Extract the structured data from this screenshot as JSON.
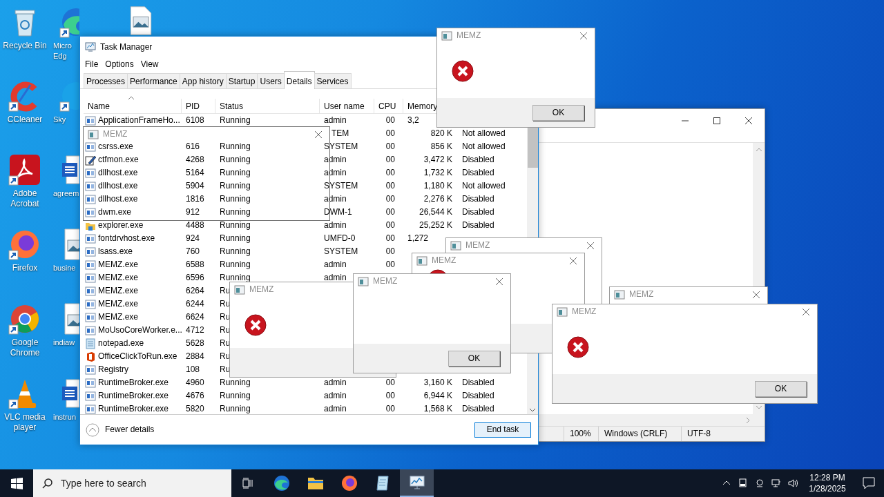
{
  "desktop_icons": [
    {
      "kind": "bin",
      "label": "Recycle Bin",
      "shortcut": false
    },
    {
      "kind": "swirl",
      "label": "Micro Edg",
      "shortcut": true
    },
    {
      "kind": "image",
      "shortcut": false
    },
    {
      "kind": "arc",
      "label": "CCleaner",
      "shortcut": true
    },
    {
      "kind": "circle",
      "label": "Sky",
      "shortcut": true
    },
    {
      "kind": "pdf",
      "label": "Adobe Acrobat",
      "shortcut": true
    },
    {
      "kind": "doc",
      "label": "agreem",
      "shortcut": false
    },
    {
      "kind": "fox",
      "label": "Firefox",
      "shortcut": true
    },
    {
      "kind": "image",
      "label": "busine",
      "shortcut": false
    },
    {
      "kind": "ring",
      "label": "Google Chrome",
      "shortcut": true
    },
    {
      "kind": "image",
      "label": "indiaw",
      "shortcut": false
    },
    {
      "kind": "cone",
      "label": "VLC media player",
      "shortcut": true
    },
    {
      "kind": "doc",
      "label": "instrun",
      "shortcut": false
    }
  ],
  "notepad": {
    "status_bar": [
      "100%",
      "Windows (CRLF)",
      "UTF-8"
    ]
  },
  "task_manager": {
    "title": "Task Manager",
    "menu": [
      "File",
      "Options",
      "View"
    ],
    "tabs": [
      {
        "label": "Processes",
        "selected": false
      },
      {
        "label": "Performance",
        "selected": false
      },
      {
        "label": "App history",
        "selected": false
      },
      {
        "label": "Startup",
        "selected": false
      },
      {
        "label": "Users",
        "selected": false
      },
      {
        "label": "Details",
        "selected": true
      },
      {
        "label": "Services",
        "selected": false
      }
    ],
    "columns": [
      "Name",
      "PID",
      "Status",
      "User name",
      "CPU",
      "Memory"
    ],
    "rows": [
      {
        "kind": "app",
        "name": "ApplicationFrameHo...",
        "pid": "6108",
        "status": "Running",
        "user": "admin",
        "cpu": "00",
        "memory": "3,2",
        "memory_cut": true
      },
      {
        "user": "TEM",
        "user_cut": true,
        "cpu": "00",
        "memory": "820 K",
        "dep": "Not allowed"
      },
      {
        "kind": "app",
        "name": "csrss.exe",
        "pid": "616",
        "status": "Running",
        "user": "SYSTEM",
        "cpu": "00",
        "memory": "856 K",
        "dep": "Not allowed"
      },
      {
        "kind": "pen",
        "name": "ctfmon.exe",
        "pid": "4268",
        "status": "Running",
        "user": "admin",
        "cpu": "00",
        "memory": "3,472 K",
        "dep": "Disabled"
      },
      {
        "kind": "app",
        "name": "dllhost.exe",
        "pid": "5164",
        "status": "Running",
        "user": "admin",
        "cpu": "00",
        "memory": "1,732 K",
        "dep": "Disabled"
      },
      {
        "kind": "app",
        "name": "dllhost.exe",
        "pid": "5904",
        "status": "Running",
        "user": "SYSTEM",
        "cpu": "00",
        "memory": "1,180 K",
        "dep": "Not allowed"
      },
      {
        "kind": "app",
        "name": "dllhost.exe",
        "pid": "1816",
        "status": "Running",
        "user": "admin",
        "cpu": "00",
        "memory": "2,276 K",
        "dep": "Disabled"
      },
      {
        "kind": "app",
        "name": "dwm.exe",
        "pid": "912",
        "status": "Running",
        "user": "DWM-1",
        "cpu": "00",
        "memory": "26,544 K",
        "dep": "Disabled"
      },
      {
        "kind": "folder",
        "name": "explorer.exe",
        "pid": "4488",
        "status": "Running",
        "user": "admin",
        "cpu": "00",
        "memory": "25,252 K",
        "dep": "Disabled"
      },
      {
        "kind": "app",
        "name": "fontdrvhost.exe",
        "pid": "924",
        "status": "Running",
        "user": "UMFD-0",
        "cpu": "00",
        "memory": "1,272",
        "memory_cut": true
      },
      {
        "kind": "app",
        "name": "lsass.exe",
        "pid": "760",
        "status": "Running",
        "user": "SYSTEM",
        "cpu": "00"
      },
      {
        "kind": "app",
        "name": "MEMZ.exe",
        "pid": "6588",
        "status": "Running",
        "user": "admin",
        "cpu": "00"
      },
      {
        "kind": "app",
        "name": "MEMZ.exe",
        "pid": "6596",
        "status": "Running",
        "user": "admin"
      },
      {
        "kind": "app",
        "name": "MEMZ.exe",
        "pid": "6264",
        "status": "Ru"
      },
      {
        "kind": "app",
        "name": "MEMZ.exe",
        "pid": "6244",
        "status": "Ru"
      },
      {
        "kind": "app",
        "name": "MEMZ.exe",
        "pid": "6624",
        "status": "Ru"
      },
      {
        "kind": "app",
        "name": "MoUsoCoreWorker.e...",
        "pid": "4712",
        "status": "Ru"
      },
      {
        "kind": "notepad",
        "name": "notepad.exe",
        "pid": "5628",
        "status": "Ru"
      },
      {
        "kind": "office",
        "name": "OfficeClickToRun.exe",
        "pid": "2884",
        "status": "Ru"
      },
      {
        "kind": "app",
        "name": "Registry",
        "pid": "108",
        "status": "Ru"
      },
      {
        "kind": "app",
        "name": "RuntimeBroker.exe",
        "pid": "4960",
        "status": "Running",
        "user": "admin",
        "cpu": "00",
        "memory": "3,160 K",
        "dep": "Disabled"
      },
      {
        "kind": "app",
        "name": "RuntimeBroker.exe",
        "pid": "4676",
        "status": "Running",
        "user": "admin",
        "cpu": "00",
        "memory": "6,944 K",
        "dep": "Disabled"
      },
      {
        "kind": "app",
        "name": "RuntimeBroker.exe",
        "pid": "5820",
        "status": "Running",
        "user": "admin",
        "cpu": "00",
        "memory": "1,568 K",
        "dep": "Disabled"
      }
    ],
    "fewer_details": "Fewer details",
    "end_task": "End task"
  },
  "dialogs": [
    {
      "kind": "ghost",
      "title": "MEMZ"
    },
    {
      "kind": "bare",
      "title": "MEMZ"
    },
    {
      "kind": "error",
      "title": "MEMZ"
    },
    {
      "kind": "error",
      "title": "MEMZ"
    },
    {
      "kind": "blank",
      "title": "MEMZ",
      "ok": "OK"
    },
    {
      "kind": "bare",
      "title": "MEMZ"
    },
    {
      "kind": "error",
      "title": "MEMZ",
      "ok": "OK"
    },
    {
      "kind": "error",
      "title": "MEMZ",
      "ok": "OK"
    }
  ],
  "taskbar": {
    "search_placeholder": "Type here to search",
    "apps": [
      {
        "kind": "swirl",
        "selected": false
      },
      {
        "kind": "folder",
        "selected": false
      },
      {
        "kind": "fox",
        "selected": false
      },
      {
        "kind": "notepad",
        "selected": false
      },
      {
        "kind": "monitor",
        "selected": true
      }
    ],
    "time": "12:28 PM",
    "date": "1/28/2025"
  }
}
